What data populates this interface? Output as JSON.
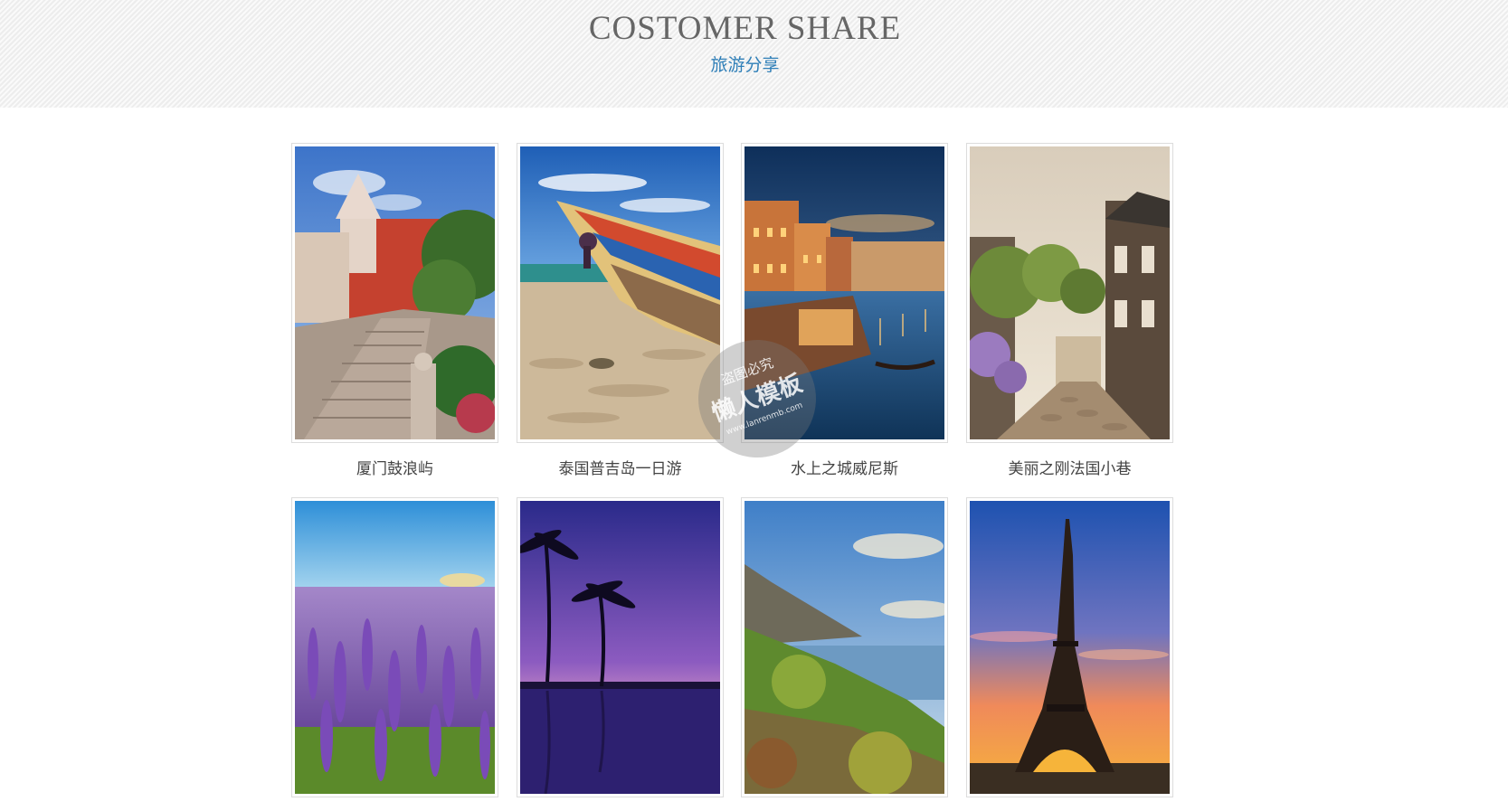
{
  "header": {
    "title": "COSTOMER SHARE",
    "subtitle": "旅游分享"
  },
  "gallery": {
    "items": [
      {
        "caption": "厦门鼓浪屿",
        "icon": "photo-xiamen-staircase"
      },
      {
        "caption": "泰国普吉岛一日游",
        "icon": "photo-phuket-boat"
      },
      {
        "caption": "水上之城威尼斯",
        "icon": "photo-venice-canal"
      },
      {
        "caption": "美丽之刚法国小巷",
        "icon": "photo-french-alley"
      },
      {
        "caption": "",
        "icon": "photo-lavender-field"
      },
      {
        "caption": "",
        "icon": "photo-palm-sunset"
      },
      {
        "caption": "",
        "icon": "photo-coastal-cliffs"
      },
      {
        "caption": "",
        "icon": "photo-eiffel-tower"
      }
    ]
  },
  "watermark": {
    "top": "盗图必究",
    "main": "懒人模板",
    "url": "www.lanrenmb.com"
  },
  "colors": {
    "accent": "#2f7fb8",
    "title": "#666666",
    "banner_bg": "#f3f3f3"
  }
}
